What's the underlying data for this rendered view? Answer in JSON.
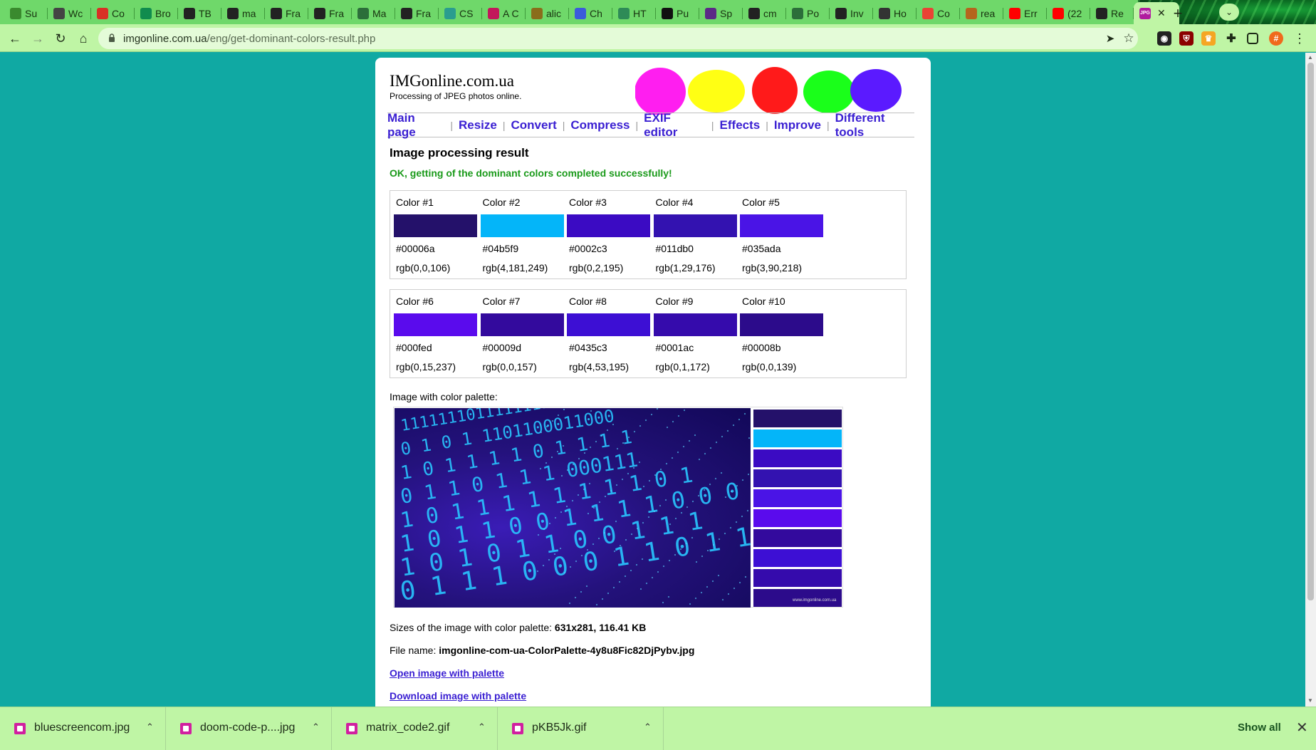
{
  "browser": {
    "tabs": [
      {
        "label": "Su",
        "icon": "chart-favicon",
        "color": "#3a8a2e"
      },
      {
        "label": "Wc",
        "icon": "wikipedia-favicon",
        "color": "#444444"
      },
      {
        "label": "Co",
        "icon": "gmail-favicon",
        "color": "#d93025"
      },
      {
        "label": "Bro",
        "icon": "bs-favicon",
        "color": "#118c4e"
      },
      {
        "label": "TB",
        "icon": "github-favicon",
        "color": "#222222"
      },
      {
        "label": "ma",
        "icon": "github-favicon",
        "color": "#222222"
      },
      {
        "label": "Fra",
        "icon": "github-favicon",
        "color": "#222222"
      },
      {
        "label": "Fra",
        "icon": "github-favicon",
        "color": "#222222"
      },
      {
        "label": "Ma",
        "icon": "globe-favicon",
        "color": "#2c6e3a"
      },
      {
        "label": "Fra",
        "icon": "github-favicon",
        "color": "#222222"
      },
      {
        "label": "CS",
        "icon": "css-favicon",
        "color": "#2a9d8f"
      },
      {
        "label": "A C",
        "icon": "star-favicon",
        "color": "#c2185b"
      },
      {
        "label": "alic",
        "icon": "pen-favicon",
        "color": "#8a6d1b"
      },
      {
        "label": "Ch",
        "icon": "flag-favicon",
        "color": "#3b5bdb"
      },
      {
        "label": "HT",
        "icon": "code-favicon",
        "color": "#2e8b57"
      },
      {
        "label": "Pu",
        "icon": "chatgpt-favicon",
        "color": "#111111"
      },
      {
        "label": "Sp",
        "icon": "spotify-favicon",
        "color": "#5b2a86"
      },
      {
        "label": "cm",
        "icon": "github-favicon",
        "color": "#222222"
      },
      {
        "label": "Po",
        "icon": "globe-favicon",
        "color": "#2c6e3a"
      },
      {
        "label": "Inv",
        "icon": "github-favicon",
        "color": "#222222"
      },
      {
        "label": "Ho",
        "icon": "ut-favicon",
        "color": "#333333"
      },
      {
        "label": "Co",
        "icon": "google-favicon",
        "color": "#ea4335"
      },
      {
        "label": "rea",
        "icon": "person-favicon",
        "color": "#b5651d"
      },
      {
        "label": "Err",
        "icon": "youtube-favicon",
        "color": "#ff0000"
      },
      {
        "label": "(22",
        "icon": "youtube-favicon",
        "color": "#ff0000"
      },
      {
        "label": "Re",
        "icon": "github-favicon",
        "color": "#222222"
      }
    ],
    "active_tab": {
      "icon": "jpg-favicon",
      "icon_text": "JPG",
      "color": "#b01c9f"
    },
    "url_host": "imgonline.com.ua",
    "url_path": "/eng/get-dominant-colors-result.php",
    "profile_initial": "#"
  },
  "site": {
    "title": "IMGonline.com.ua",
    "subtitle": "Processing of JPEG photos online.",
    "blob_colors": [
      "#ff1ef0",
      "#ffff14",
      "#ff1a1a",
      "#1aff1a",
      "#5b1aff"
    ],
    "nav": [
      "Main page",
      "Resize",
      "Convert",
      "Compress",
      "EXIF editor",
      "Effects",
      "Improve",
      "Different tools"
    ]
  },
  "result": {
    "heading": "Image processing result",
    "status": "OK, getting of the dominant colors completed successfully!",
    "colors": [
      {
        "label": "Color #1",
        "hex": "#00006a",
        "rgb": "rgb(0,0,106)",
        "swatch": "#24116a"
      },
      {
        "label": "Color #2",
        "hex": "#04b5f9",
        "rgb": "rgb(4,181,249)",
        "swatch": "#04b5f9"
      },
      {
        "label": "Color #3",
        "hex": "#0002c3",
        "rgb": "rgb(0,2,195)",
        "swatch": "#3b0bc3"
      },
      {
        "label": "Color #4",
        "hex": "#011db0",
        "rgb": "rgb(1,29,176)",
        "swatch": "#3312b0"
      },
      {
        "label": "Color #5",
        "hex": "#035ada",
        "rgb": "rgb(3,90,218)",
        "swatch": "#4a14e6"
      },
      {
        "label": "Color #6",
        "hex": "#000fed",
        "rgb": "rgb(0,15,237)",
        "swatch": "#5a0bed"
      },
      {
        "label": "Color #7",
        "hex": "#00009d",
        "rgb": "rgb(0,0,157)",
        "swatch": "#330a9d"
      },
      {
        "label": "Color #8",
        "hex": "#0435c3",
        "rgb": "rgb(4,53,195)",
        "swatch": "#3d0fd4"
      },
      {
        "label": "Color #9",
        "hex": "#0001ac",
        "rgb": "rgb(0,1,172)",
        "swatch": "#350bac"
      },
      {
        "label": "Color #10",
        "hex": "#00008b",
        "rgb": "rgb(0,0,139)",
        "swatch": "#2c0b8b"
      }
    ],
    "palette_label": "Image with color palette:",
    "watermark": "www.imgonline.com.ua",
    "matrix_rows": [
      "1111111011111111",
      "0 1 0 1 1101100011000",
      "1 0 1 1 1 1 0 1 1 1 1",
      "0 1 1 0 1 1 1 000111",
      "1 0 1 1 1 1 1 1 1 1 0 1",
      "1 0 1 1 0 0 1 1 1 1 0 0 0 0 1 0",
      "1 0 1 0 1 1 0 0 1 1 1",
      "0 1 1 1 0 0 0 1 1 0 1 1"
    ],
    "sizes_label": "Sizes of the image with color palette:",
    "sizes_value": "631x281, 116.41 KB",
    "filename_label": "File name:",
    "filename_value": "imgonline-com-ua-ColorPalette-4y8u8Fic82DjPybv.jpg",
    "open_link": "Open image with palette",
    "download_link": "Download image with palette"
  },
  "downloads": {
    "items": [
      "bluescreencom.jpg",
      "doom-code-p....jpg",
      "matrix_code2.gif",
      "pKB5Jk.gif"
    ],
    "show_all": "Show all"
  }
}
